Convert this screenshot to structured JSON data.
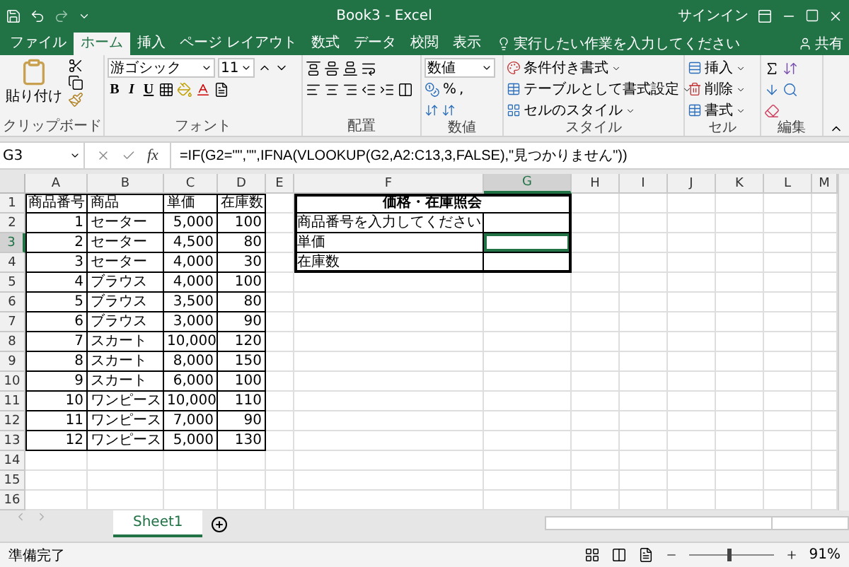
{
  "title_bar": {
    "title": "Book3 - Excel",
    "signin": "サインイン"
  },
  "tabs": [
    {
      "label": "ファイル",
      "selected": false
    },
    {
      "label": "ホーム",
      "selected": true
    },
    {
      "label": "挿入",
      "selected": false
    },
    {
      "label": "ページ レイアウト",
      "selected": false
    },
    {
      "label": "数式",
      "selected": false
    },
    {
      "label": "データ",
      "selected": false
    },
    {
      "label": "校閲",
      "selected": false
    },
    {
      "label": "表示",
      "selected": false
    }
  ],
  "tell_me": "実行したい作業を入力してください",
  "share": "共有",
  "ribbon": {
    "clipboard": {
      "paste": "貼り付け",
      "label": "クリップボード"
    },
    "font": {
      "name": "游ゴシック",
      "size": "11",
      "styles": [
        "B",
        "I",
        "U"
      ],
      "label": "フォント"
    },
    "alignment": {
      "label": "配置"
    },
    "number": {
      "format": "数値",
      "percent": "%",
      "comma": ",",
      "label": "数値"
    },
    "styles": {
      "items": [
        "条件付き書式",
        "テーブルとして書式設定",
        "セルのスタイル"
      ],
      "label": "スタイル"
    },
    "cells": {
      "items": [
        "挿入",
        "削除",
        "書式"
      ],
      "label": "セル"
    },
    "editing": {
      "label": "編集"
    }
  },
  "formula_bar": {
    "name_box": "G3",
    "fx": "fx",
    "formula": "=IF(G2=\"\",\"\",IFNA(VLOOKUP(G2,A2:C13,3,FALSE),\"見つかりません\"))"
  },
  "columns": [
    {
      "label": "A",
      "selected": false
    },
    {
      "label": "B",
      "selected": false
    },
    {
      "label": "C",
      "selected": false
    },
    {
      "label": "D",
      "selected": false
    },
    {
      "label": "E",
      "selected": false
    },
    {
      "label": "F",
      "selected": false
    },
    {
      "label": "G",
      "selected": true
    },
    {
      "label": "H",
      "selected": false
    },
    {
      "label": "I",
      "selected": false
    },
    {
      "label": "J",
      "selected": false
    },
    {
      "label": "K",
      "selected": false
    },
    {
      "label": "L",
      "selected": false
    },
    {
      "label": "M",
      "selected": false
    }
  ],
  "rows": [
    {
      "label": "1",
      "selected": false
    },
    {
      "label": "2",
      "selected": false
    },
    {
      "label": "3",
      "selected": true
    },
    {
      "label": "4",
      "selected": false
    },
    {
      "label": "5",
      "selected": false
    },
    {
      "label": "6",
      "selected": false
    },
    {
      "label": "7",
      "selected": false
    },
    {
      "label": "8",
      "selected": false
    },
    {
      "label": "9",
      "selected": false
    },
    {
      "label": "10",
      "selected": false
    },
    {
      "label": "11",
      "selected": false
    },
    {
      "label": "12",
      "selected": false
    },
    {
      "label": "13",
      "selected": false
    },
    {
      "label": "14",
      "selected": false
    },
    {
      "label": "15",
      "selected": false
    },
    {
      "label": "16",
      "selected": false
    }
  ],
  "table": {
    "header": [
      "商品番号",
      "商品",
      "単価",
      "在庫数"
    ],
    "rows": [
      [
        "1",
        "セーター",
        "5,000",
        "100"
      ],
      [
        "2",
        "セーター",
        "4,500",
        "80"
      ],
      [
        "3",
        "セーター",
        "4,000",
        "30"
      ],
      [
        "4",
        "ブラウス",
        "4,000",
        "100"
      ],
      [
        "5",
        "ブラウス",
        "3,500",
        "80"
      ],
      [
        "6",
        "ブラウス",
        "3,000",
        "90"
      ],
      [
        "7",
        "スカート",
        "10,000",
        "120"
      ],
      [
        "8",
        "スカート",
        "8,000",
        "150"
      ],
      [
        "9",
        "スカート",
        "6,000",
        "100"
      ],
      [
        "10",
        "ワンピース",
        "10,000",
        "110"
      ],
      [
        "11",
        "ワンピース",
        "7,000",
        "90"
      ],
      [
        "12",
        "ワンピース",
        "5,000",
        "130"
      ]
    ]
  },
  "lookup": {
    "title": "価格・在庫照会",
    "labels": [
      "商品番号を入力してください",
      "単価",
      "在庫数"
    ]
  },
  "sheet_tabs": [
    {
      "label": "Sheet1",
      "selected": true
    }
  ],
  "status_bar": {
    "status": "準備完了",
    "zoom": "91%",
    "zoom_slider": {
      "level": 0.45
    }
  }
}
